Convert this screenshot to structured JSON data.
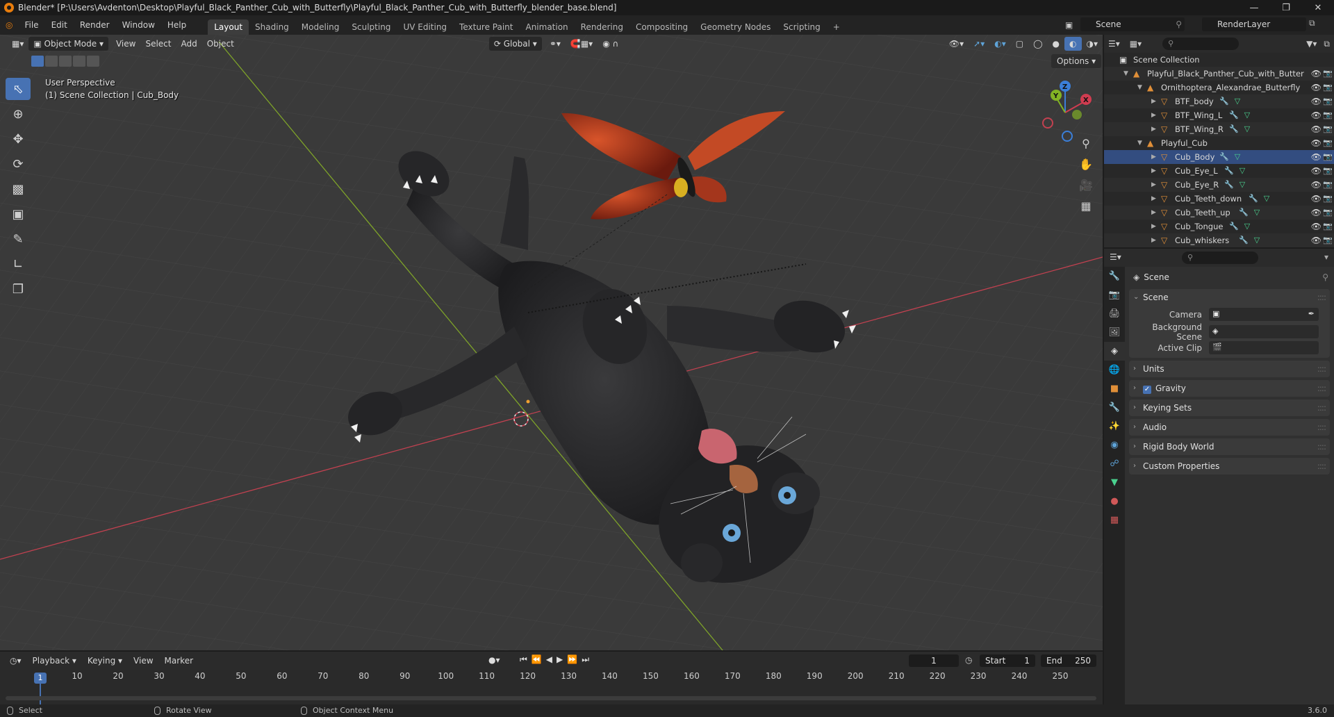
{
  "window": {
    "title": "Blender* [P:\\Users\\Avdenton\\Desktop\\Playful_Black_Panther_Cub_with_Butterfly\\Playful_Black_Panther_Cub_with_Butterfly_blender_base.blend]"
  },
  "menu": [
    "File",
    "Edit",
    "Render",
    "Window",
    "Help"
  ],
  "workspaces": [
    "Layout",
    "Shading",
    "Modeling",
    "Sculpting",
    "UV Editing",
    "Texture Paint",
    "Animation",
    "Rendering",
    "Compositing",
    "Geometry Nodes",
    "Scripting"
  ],
  "active_workspace": "Layout",
  "add_workspace_label": "+",
  "scene_name": "Scene",
  "view_layer": "RenderLayer",
  "viewport": {
    "mode": "Object Mode",
    "menus": [
      "View",
      "Select",
      "Add",
      "Object"
    ],
    "transform_orientation": "Global",
    "options_label": "Options",
    "info_line1": "User Perspective",
    "info_line2": "(1) Scene Collection | Cub_Body",
    "gizmo_axes": {
      "x": "X",
      "y": "Y",
      "z": "Z"
    }
  },
  "outliner": {
    "root": "Scene Collection",
    "rows": [
      {
        "label": "Playful_Black_Panther_Cub_with_Butter",
        "depth": 1,
        "type": "collection",
        "expanded": true
      },
      {
        "label": "Ornithoptera_Alexandrae_Butterfly",
        "depth": 2,
        "type": "collection",
        "expanded": true
      },
      {
        "label": "BTF_body",
        "depth": 3,
        "type": "mesh"
      },
      {
        "label": "BTF_Wing_L",
        "depth": 3,
        "type": "mesh"
      },
      {
        "label": "BTF_Wing_R",
        "depth": 3,
        "type": "mesh"
      },
      {
        "label": "Playful_Cub",
        "depth": 2,
        "type": "collection",
        "expanded": true
      },
      {
        "label": "Cub_Body",
        "depth": 3,
        "type": "mesh",
        "active": true
      },
      {
        "label": "Cub_Eye_L",
        "depth": 3,
        "type": "mesh"
      },
      {
        "label": "Cub_Eye_R",
        "depth": 3,
        "type": "mesh"
      },
      {
        "label": "Cub_Teeth_down",
        "depth": 3,
        "type": "mesh"
      },
      {
        "label": "Cub_Teeth_up",
        "depth": 3,
        "type": "mesh"
      },
      {
        "label": "Cub_Tongue",
        "depth": 3,
        "type": "mesh"
      },
      {
        "label": "Cub_whiskers",
        "depth": 3,
        "type": "mesh"
      }
    ]
  },
  "properties": {
    "context": "Scene",
    "scene_panel": {
      "title": "Scene",
      "camera_label": "Camera",
      "background_scene_label": "Background Scene",
      "active_clip_label": "Active Clip"
    },
    "collapsed_panels": [
      "Units",
      "Gravity",
      "Keying Sets",
      "Audio",
      "Rigid Body World",
      "Custom Properties"
    ],
    "gravity_checked": true
  },
  "timeline": {
    "menus": [
      "Playback",
      "Keying",
      "View",
      "Marker"
    ],
    "current_frame": "1",
    "start_label": "Start",
    "start": "1",
    "end_label": "End",
    "end": "250",
    "ruler": [
      "10",
      "20",
      "30",
      "40",
      "50",
      "60",
      "70",
      "80",
      "90",
      "100",
      "110",
      "120",
      "130",
      "140",
      "150",
      "160",
      "170",
      "180",
      "190",
      "200",
      "210",
      "220",
      "230",
      "240",
      "250"
    ],
    "playhead_label": "1"
  },
  "status": {
    "select": "Select",
    "rotate": "Rotate View",
    "context_menu": "Object Context Menu",
    "version": "3.6.0"
  },
  "colors": {
    "accent": "#4772b3",
    "x_axis": "#d03c50",
    "y_axis": "#82b324",
    "z_axis": "#3b7fd9"
  }
}
